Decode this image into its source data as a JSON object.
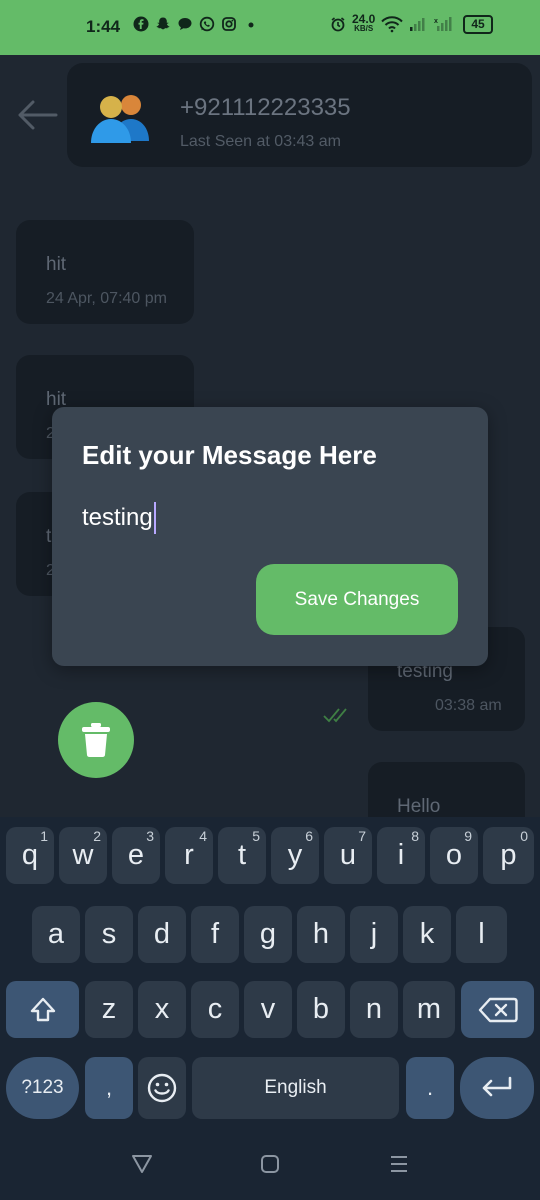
{
  "status_bar": {
    "time": "1:44",
    "notification_icons": [
      "facebook-icon",
      "snapchat-icon",
      "message-icon",
      "whatsapp-icon",
      "instagram-icon",
      "dot-icon"
    ],
    "speed_value": "24.0",
    "speed_unit": "KB/S",
    "battery": "45",
    "colors": {
      "background": "#64bb68"
    }
  },
  "header": {
    "contact_name": "+921112223335",
    "last_seen": "Last Seen at 03:43 am"
  },
  "messages": [
    {
      "text": "hit",
      "time": "24 Apr, 07:40 pm",
      "side": "received"
    },
    {
      "text": "hit",
      "time": "2",
      "side": "received"
    },
    {
      "text": "t",
      "time": "2",
      "side": "received"
    },
    {
      "text": "testing",
      "time": "03:38 am",
      "side": "sent"
    },
    {
      "text": "Hello",
      "time": "",
      "side": "sent"
    }
  ],
  "dialog": {
    "title": "Edit your Message Here",
    "input_value": "testing",
    "save_label": "Save Changes"
  },
  "keyboard": {
    "row1": [
      {
        "label": "q",
        "hint": "1"
      },
      {
        "label": "w",
        "hint": "2"
      },
      {
        "label": "e",
        "hint": "3"
      },
      {
        "label": "r",
        "hint": "4"
      },
      {
        "label": "t",
        "hint": "5"
      },
      {
        "label": "y",
        "hint": "6"
      },
      {
        "label": "u",
        "hint": "7"
      },
      {
        "label": "i",
        "hint": "8"
      },
      {
        "label": "o",
        "hint": "9"
      },
      {
        "label": "p",
        "hint": "0"
      }
    ],
    "row2": [
      "a",
      "s",
      "d",
      "f",
      "g",
      "h",
      "j",
      "k",
      "l"
    ],
    "row3": [
      "z",
      "x",
      "c",
      "v",
      "b",
      "n",
      "m"
    ],
    "symbols_label": "?123",
    "comma_label": ",",
    "space_label": "English",
    "period_label": "."
  },
  "colors": {
    "accent": "#64bb68",
    "background": "#1f2731",
    "dialog": "#3a4551",
    "keyboard": "#1a2533"
  }
}
